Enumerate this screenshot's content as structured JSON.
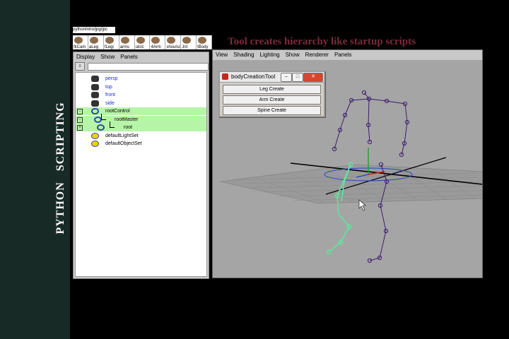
{
  "slide": {
    "side_title": "PYTHON   SCRIPTING",
    "title": "Tool creates hierarchy like startup scripts"
  },
  "shelf": {
    "label": "pythonIntro/jpg/jpc",
    "buttons": [
      "fkCam",
      "aLeg",
      "fLegi",
      "arms",
      "ulclc",
      "4Arm",
      "shoulsc",
      "Jnt",
      "tBody"
    ]
  },
  "outliner": {
    "menu": [
      "Display",
      "Show",
      "Panels"
    ],
    "items": [
      {
        "name": "persp",
        "icon": "camera-icon",
        "indent": 0,
        "selected": false,
        "expander": ""
      },
      {
        "name": "top",
        "icon": "camera-icon",
        "indent": 0,
        "selected": false,
        "expander": ""
      },
      {
        "name": "front",
        "icon": "camera-icon",
        "indent": 0,
        "selected": false,
        "expander": ""
      },
      {
        "name": "side",
        "icon": "camera-icon",
        "indent": 0,
        "selected": false,
        "expander": ""
      },
      {
        "name": "rootControl",
        "icon": "curve-control-icon",
        "indent": 0,
        "selected": true,
        "expander": "-"
      },
      {
        "name": "rootMaster",
        "icon": "joint-icon",
        "indent": 1,
        "selected": true,
        "expander": "-"
      },
      {
        "name": "root",
        "icon": "joint-icon",
        "indent": 2,
        "selected": true,
        "expander": "+"
      },
      {
        "name": "defaultLightSet",
        "icon": "set-icon",
        "indent": 0,
        "selected": false,
        "expander": ""
      },
      {
        "name": "defaultObjectSet",
        "icon": "set-icon",
        "indent": 0,
        "selected": false,
        "expander": ""
      }
    ]
  },
  "viewport": {
    "menu": [
      "View",
      "Shading",
      "Lighting",
      "Show",
      "Renderer",
      "Panels"
    ]
  },
  "tool_window": {
    "title": "bodyCreationTool",
    "buttons": [
      "Leg Create",
      "Arm Create",
      "Spine Create"
    ]
  },
  "colors": {
    "selected_joint": "#5ee6a0",
    "joint": "#3b1c6e",
    "outliner_selection": "#b6f5a8",
    "title_text": "#7b2a3a"
  }
}
